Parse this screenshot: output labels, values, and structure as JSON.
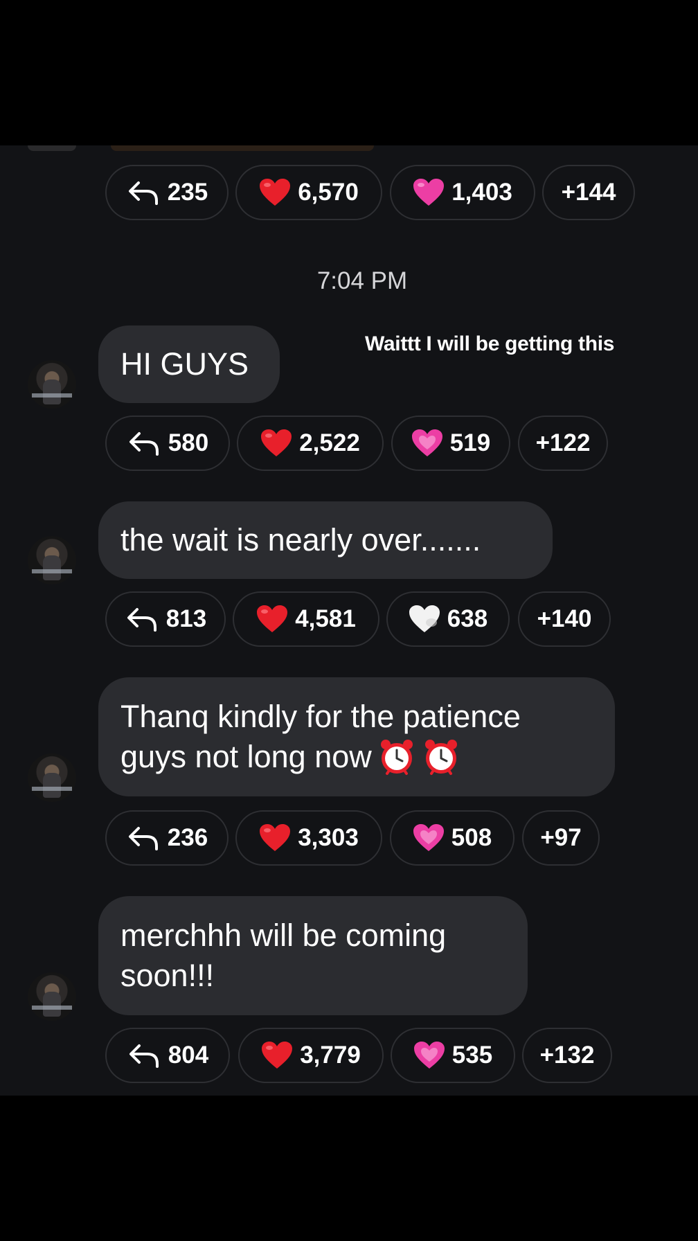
{
  "timestamp": "7:04 PM",
  "overlay_caption": "Waittt I will be getting this",
  "top_reactions": {
    "reply_count": "235",
    "red_heart_count": "6,570",
    "pink_heart_count": "1,403",
    "more_count": "+144"
  },
  "messages": [
    {
      "text": "HI GUYS",
      "reactions": {
        "reply_count": "580",
        "red_heart_count": "2,522",
        "second_emoji": "sparkling-heart",
        "second_count": "519",
        "more_count": "+122"
      }
    },
    {
      "text": "the wait is nearly over.......",
      "reactions": {
        "reply_count": "813",
        "red_heart_count": "4,581",
        "second_emoji": "white-heart",
        "second_count": "638",
        "more_count": "+140"
      }
    },
    {
      "text_line1": "Thanq kindly for the patience",
      "text_line2": "guys not long now",
      "reactions": {
        "reply_count": "236",
        "red_heart_count": "3,303",
        "second_emoji": "sparkling-heart",
        "second_count": "508",
        "more_count": "+97"
      }
    },
    {
      "text_line1": "merchhh will be coming",
      "text_line2": "soon!!!",
      "reactions": {
        "reply_count": "804",
        "red_heart_count": "3,779",
        "second_emoji": "sparkling-heart",
        "second_count": "535",
        "more_count": "+132"
      }
    }
  ],
  "colors": {
    "background": "#000000",
    "chat_background": "#121316",
    "bubble": "#2b2c30",
    "pill_border": "#2e2f33",
    "red_heart": "#e8202b",
    "pink_heart": "#ec3ea4",
    "white_heart": "#f2f2f2"
  }
}
